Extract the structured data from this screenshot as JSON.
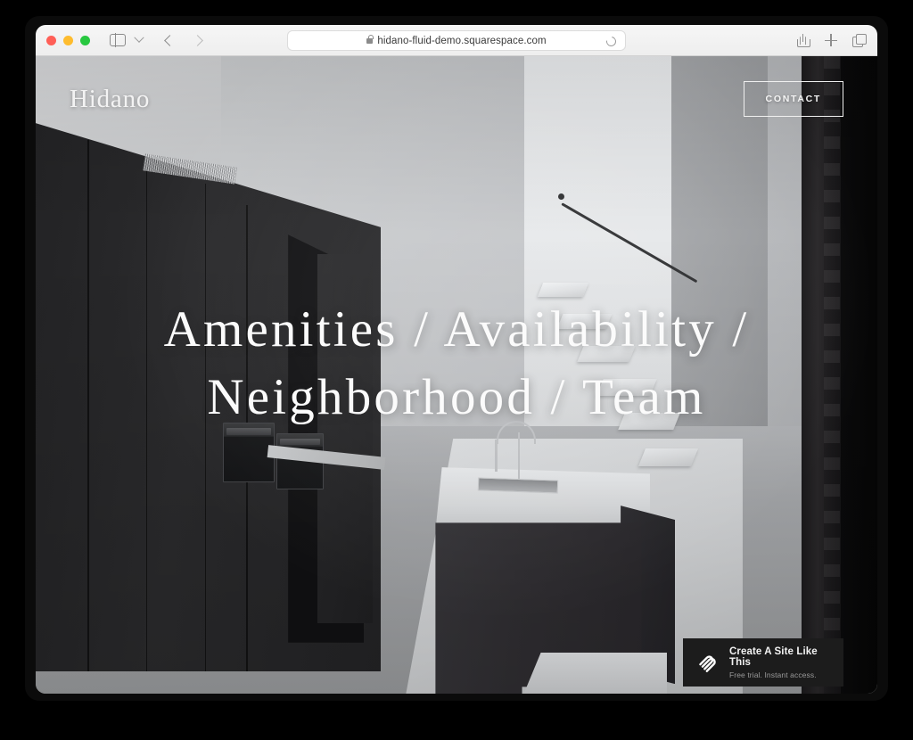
{
  "browser": {
    "url": "hidano-fluid-demo.squarespace.com",
    "traffic_lights": [
      {
        "name": "close",
        "color": "#ff5f57"
      },
      {
        "name": "minimize",
        "color": "#febc2e"
      },
      {
        "name": "zoom",
        "color": "#28c840"
      }
    ],
    "icons": {
      "sidebar_toggle": "sidebar-toggle-icon",
      "tab_group_chevron": "chevron-down-icon",
      "back": "back-arrow-icon",
      "forward": "forward-arrow-icon",
      "lock": "lock-icon",
      "reload": "reload-icon",
      "share": "share-icon",
      "new_tab": "plus-icon",
      "tab_overview": "tabs-overview-icon"
    }
  },
  "site": {
    "logo": "Hidano",
    "contact_label": "CONTACT",
    "headline_lines": [
      "Amenities / Availability /",
      "Neighborhood / Team"
    ],
    "nav_items": [
      "Amenities",
      "Availability",
      "Neighborhood",
      "Team"
    ],
    "colors": {
      "headline": "#fbfbfb",
      "badge_background": "#1c1c1c",
      "page_backdrop": "#000000"
    }
  },
  "badge": {
    "logo": "squarespace-logo-icon",
    "title": "Create A Site Like This",
    "subtitle": "Free trial. Instant access."
  }
}
